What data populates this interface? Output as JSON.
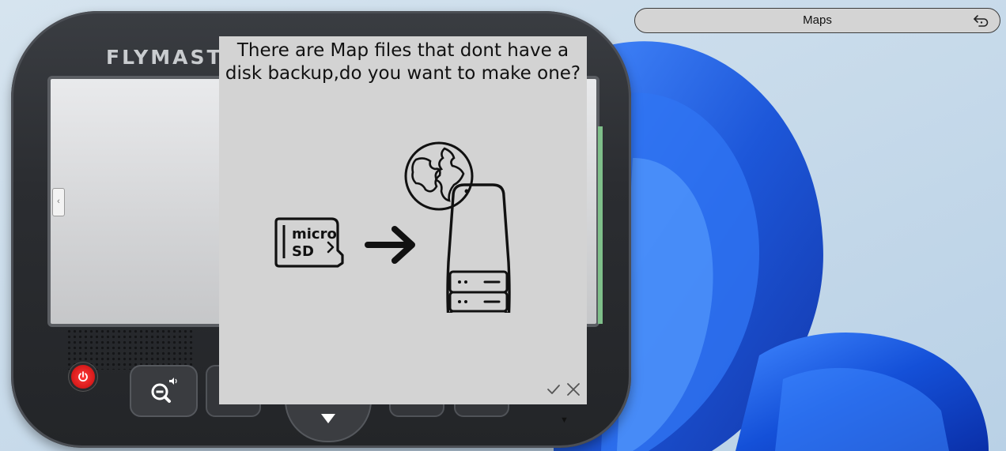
{
  "device": {
    "brand": "FLYMASTE"
  },
  "top_bar": {
    "title": "Maps",
    "back_icon": "back-arrow-icon"
  },
  "dialog": {
    "message_line1": "There are Map files that dont have a",
    "message_line2": "disk backup,do you want to make one?",
    "sd_card_text_line1": "micro",
    "sd_card_text_line2": "SD",
    "confirm_icon": "check-icon",
    "cancel_icon": "close-icon"
  },
  "colors": {
    "dialog_bg": "#d3d3d3",
    "device_body": "#2b2d31",
    "power_red": "#e01515",
    "wallpaper_blue": "#1f5fe0"
  }
}
